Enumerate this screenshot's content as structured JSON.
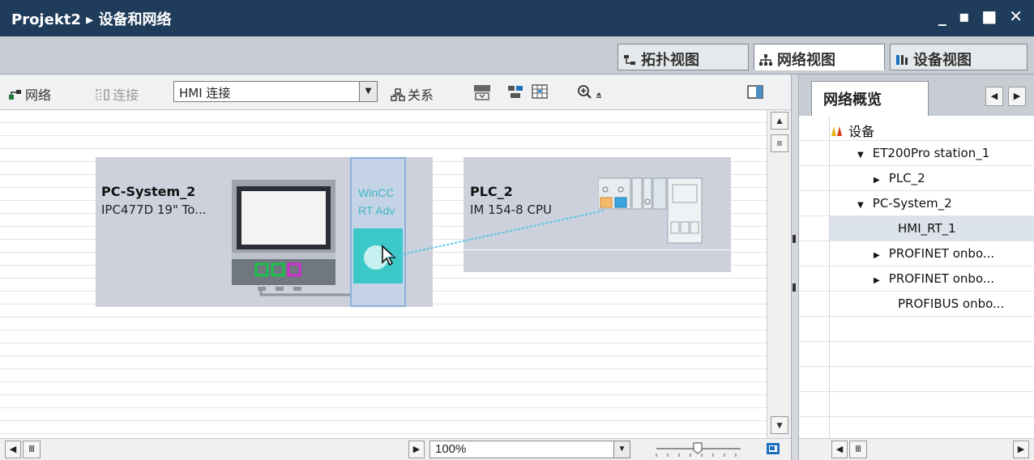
{
  "title_bar": {
    "title": "Projekt2 ▸ 设备和网络",
    "controls": "_ ▪ ■ ✕"
  },
  "view_tabs": [
    {
      "label": "拓扑视图",
      "icon": "topology-view-icon",
      "active": false
    },
    {
      "label": "网络视图",
      "icon": "network-view-icon",
      "active": true
    },
    {
      "label": "设备视图",
      "icon": "device-view-icon",
      "active": false
    }
  ],
  "toolbar": {
    "network_label": "网络",
    "connect_label": "连接",
    "connection_type_value": "HMI 连接",
    "relations_label": "关系"
  },
  "canvas": {
    "stations": [
      {
        "name": "PC-System_2",
        "subtitle": "IPC477D 19\" To..."
      },
      {
        "name": "PLC_2",
        "subtitle": "IM 154-8 CPU"
      }
    ],
    "wincc_box": {
      "line1": "WinCC",
      "line2": "RT Adv"
    }
  },
  "zoom": {
    "value": "100%"
  },
  "right_panel": {
    "tab_label": "网络概览",
    "tree_header": "设备",
    "tree": [
      {
        "label": "ET200Pro station_1",
        "expander": "▼",
        "level": 1,
        "selected": false
      },
      {
        "label": "PLC_2",
        "expander": "▶",
        "level": 2,
        "selected": false
      },
      {
        "label": "PC-System_2",
        "expander": "▼",
        "level": 1,
        "selected": false
      },
      {
        "label": "HMI_RT_1",
        "expander": "",
        "level": 3,
        "selected": true
      },
      {
        "label": "PROFINET onbo...",
        "expander": "▶",
        "level": 2,
        "selected": false
      },
      {
        "label": "PROFINET onbo...",
        "expander": "▶",
        "level": 2,
        "selected": false
      },
      {
        "label": "PROFIBUS onbo...",
        "expander": "",
        "level": 3,
        "selected": false
      }
    ]
  },
  "colors": {
    "title_bar": "#1f3c5b",
    "station_bg": "#ccd1db",
    "wincc_teal": "#3cc8c8",
    "connection_line": "#4fc3e8",
    "port_green": "#19c24a",
    "port_magenta": "#d12bd1"
  }
}
